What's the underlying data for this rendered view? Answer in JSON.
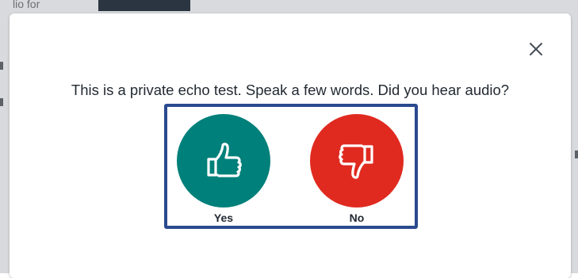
{
  "background": {
    "fragment_text": "lio for"
  },
  "dialog": {
    "prompt": "This is a private echo test. Speak a few words. Did you hear audio?",
    "close_icon": "close-icon",
    "choices": [
      {
        "label": "Yes",
        "icon": "thumbs-up-icon",
        "color": "#00807a"
      },
      {
        "label": "No",
        "icon": "thumbs-down-icon",
        "color": "#e02a20"
      }
    ],
    "focus_ring_color": "#2a4a8e"
  }
}
